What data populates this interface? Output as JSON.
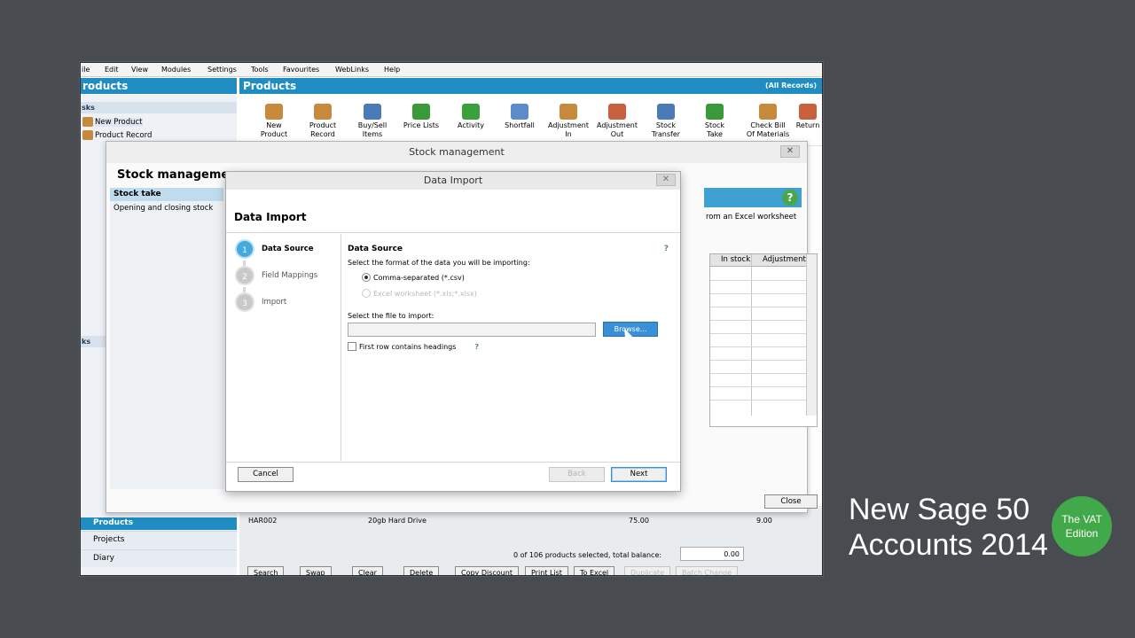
{
  "menubar": [
    "ile",
    "Edit",
    "View",
    "Modules",
    "Settings",
    "Tools",
    "Favourites",
    "WebLinks",
    "Help"
  ],
  "left_header": "roducts",
  "sidebar": {
    "tasks_label": "sks",
    "task_items": [
      "New Product",
      "Product Record"
    ],
    "links_label": "ks",
    "nav_active": "Products",
    "nav_items": [
      "Projects",
      "Diary"
    ]
  },
  "main_header": {
    "title": "Products",
    "records": "(All Records)"
  },
  "toolbar": [
    {
      "label1": "New",
      "label2": "Product",
      "color": "#c78a3c"
    },
    {
      "label1": "Product",
      "label2": "Record",
      "color": "#c78a3c"
    },
    {
      "label1": "Buy/Sell",
      "label2": "Items",
      "color": "#4a7bb8"
    },
    {
      "label1": "Price Lists",
      "label2": "",
      "color": "#3a9a3a"
    },
    {
      "label1": "Activity",
      "label2": "",
      "color": "#3aa03a"
    },
    {
      "label1": "Shortfall",
      "label2": "",
      "color": "#5b8cc9"
    },
    {
      "label1": "Adjustment",
      "label2": "In",
      "color": "#c78a3c"
    },
    {
      "label1": "Adjustment",
      "label2": "Out",
      "color": "#c7603c"
    },
    {
      "label1": "Stock",
      "label2": "Transfer",
      "color": "#4a7bb8"
    },
    {
      "label1": "Stock",
      "label2": "Take",
      "color": "#3a9a3a"
    },
    {
      "label1": "Check Bill",
      "label2": "Of Materials",
      "color": "#c78a3c"
    },
    {
      "label1": "Return",
      "label2": "",
      "color": "#c7603c"
    }
  ],
  "stock_mgmt": {
    "window_title": "Stock management",
    "heading": "Stock manageme",
    "nav_active": "Stock take",
    "nav_item": "Opening and closing stock",
    "desc": "rom an Excel worksheet",
    "grid_headers": [
      "In stock",
      "Adjustment"
    ],
    "close_label": "Close"
  },
  "data_import": {
    "window_title": "Data Import",
    "heading": "Data Import",
    "steps": [
      {
        "num": "1",
        "label": "Data Source"
      },
      {
        "num": "2",
        "label": "Field Mappings"
      },
      {
        "num": "3",
        "label": "Import"
      }
    ],
    "section_title": "Data Source",
    "help": "?",
    "format_prompt": "Select the format of the data you will be importing:",
    "option_csv": "Comma-separated (*.csv)",
    "option_excel": "Excel worksheet (*.xls;*.xlsx)",
    "file_prompt": "Select the file to import:",
    "file_value": "",
    "browse_label": "Browse...",
    "headings_label": "First row contains headings",
    "cancel_label": "Cancel",
    "back_label": "Back",
    "next_label": "Next"
  },
  "bottom": {
    "row_code": "HAR002",
    "row_desc": "20gb Hard Drive",
    "row_price": "75.00",
    "row_qty": "9.00",
    "status": "0 of 106 products selected, total balance:",
    "balance": "0.00",
    "buttons": [
      "Search",
      "Swap",
      "Clear",
      "Delete",
      "Copy Discount",
      "Print List",
      "To Excel",
      "Duplicate",
      "Batch Change"
    ]
  },
  "brand": {
    "line1": "New Sage 50",
    "line2": "Accounts 2014",
    "badge1": "The VAT",
    "badge2": "Edition"
  },
  "colors": {
    "accent": "#1f8cc2",
    "badge": "#41a94a",
    "active_step": "#43a9de"
  }
}
